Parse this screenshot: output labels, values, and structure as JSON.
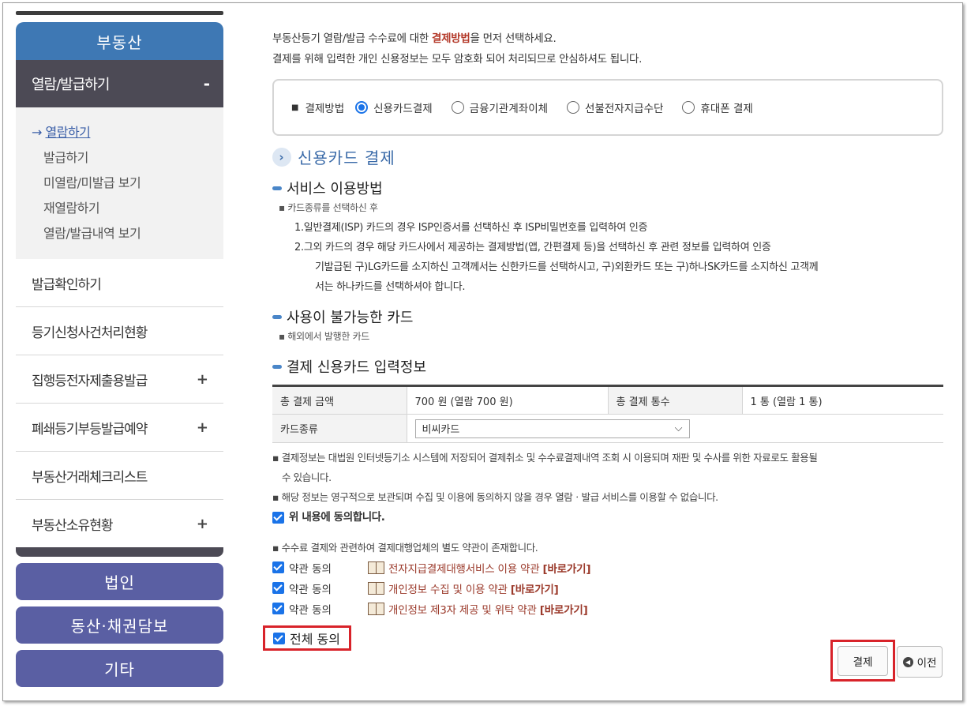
{
  "sidebar": {
    "section_title": "부동산",
    "active_menu": {
      "label": "열람/발급하기",
      "toggle": "-"
    },
    "sub_items": [
      {
        "prefix": "→",
        "label": "열람하기"
      },
      {
        "label": "발급하기"
      },
      {
        "label": "미열람/미발급 보기"
      },
      {
        "label": "재열람하기"
      },
      {
        "label": "열람/발급내역 보기"
      }
    ],
    "menus": [
      {
        "label": "발급확인하기",
        "toggle": ""
      },
      {
        "label": "등기신청사건처리현황",
        "toggle": ""
      },
      {
        "label": "집행등전자제출용발급",
        "toggle": "+"
      },
      {
        "label": "폐쇄등기부등발급예약",
        "toggle": "+"
      },
      {
        "label": "부동산거래체크리스트",
        "toggle": ""
      },
      {
        "label": "부동산소유현황",
        "toggle": "+"
      }
    ],
    "bottom_buttons": [
      "법인",
      "동산·채권담보",
      "기타"
    ]
  },
  "intro": {
    "line1_pre": "부동산등기 열람/발급 수수료에 대한 ",
    "line1_hl": "결제방법",
    "line1_post": "을 먼저 선택하세요.",
    "line2": "결제를 위해 입력한 개인 신용정보는 모두 암호화 되어 처리되므로 안심하셔도 됩니다."
  },
  "payment_method": {
    "label": "결제방법",
    "options": [
      "신용카드결제",
      "금융기관계좌이체",
      "선불전자지급수단",
      "휴대폰 결제"
    ],
    "selected": "신용카드결제"
  },
  "card_section_title": "신용카드 결제",
  "service_usage": {
    "title": "서비스 이용방법",
    "lines": [
      "카드종류를 선택하신 후",
      "1.일반결제(ISP) 카드의 경우 ISP인증서를 선택하신 후 ISP비밀번호를 입력하여 인증",
      "2.그외 카드의 경우 해당 카드사에서 제공하는 결제방법(앱, 간편결제 등)을 선택하신 후 관련 정보를 입력하여 인증",
      "기발급된 구)LG카드를 소지하신 고객께서는 신한카드를 선택하시고, 구)외환카드 또는 구)하나SK카드를 소지하신 고객께",
      "서는 하나카드를 선택하셔야 합니다."
    ]
  },
  "unavailable": {
    "title": "사용이 불가능한 카드",
    "line": "해외에서 발행한 카드"
  },
  "card_input": {
    "title": "결제 신용카드 입력정보",
    "total_amount_label": "총 결제 금액",
    "total_amount_value": "700 원 (열람 700 원)",
    "total_count_label": "총 결제 통수",
    "total_count_value": "1 통 (열람 1 통)",
    "card_type_label": "카드종류",
    "card_type_value": "비씨카드"
  },
  "notes": {
    "n1a": "결제정보는 대법원 인터넷등기소 시스템에 저장되어 결제취소 및 수수료결제내역 조회 시 이용되며 재판 및 수사를 위한 자료로도 활용될",
    "n1b": "수 있습니다.",
    "n2": "해당 정보는 영구적으로 보관되며 수집 및 이용에 동의하지 않을 경우 열람ㆍ발급 서비스를 이용할 수 없습니다.",
    "agree": "위 내용에 동의합니다.",
    "n3": "수수료 결제와 관련하여 결제대행업체의 별도 약관이 존재합니다."
  },
  "terms": [
    {
      "label": "약관 동의",
      "link": "전자지급결제대행서비스 이용 약관",
      "go": "[바로가기]"
    },
    {
      "label": "약관 동의",
      "link": "개인정보 수집 및 이용 약관",
      "go": "[바로가기]"
    },
    {
      "label": "약관 동의",
      "link": "개인정보 제3자 제공 및 위탁 약관",
      "go": "[바로가기]"
    }
  ],
  "all_agree": "전체 동의",
  "buttons": {
    "pay": "결제",
    "prev": "이전"
  }
}
